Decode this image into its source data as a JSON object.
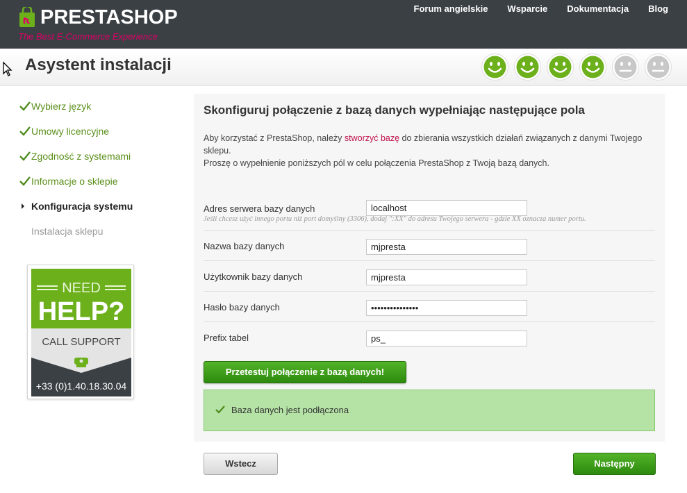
{
  "header": {
    "logo_name": "PRESTASHOP",
    "logo_tagline": "The Best E-Commerce Experience",
    "nav": [
      "Forum angielskie",
      "Wsparcie",
      "Dokumentacja",
      "Blog"
    ]
  },
  "title": "Asystent instalacji",
  "progress": {
    "completed_steps": 4,
    "total_steps": 6
  },
  "sidebar": {
    "steps": [
      {
        "label": "Wybierz język",
        "state": "done"
      },
      {
        "label": "Umowy licencyjne",
        "state": "done"
      },
      {
        "label": "Zgodność z systemami",
        "state": "done"
      },
      {
        "label": "Informacje o sklepie",
        "state": "done"
      },
      {
        "label": "Konfiguracja systemu",
        "state": "current"
      },
      {
        "label": "Instalacja sklepu",
        "state": "pending"
      }
    ]
  },
  "help": {
    "need": "NEED",
    "help": "HELP?",
    "call": "CALL SUPPORT",
    "phone": "+33 (0)1.40.18.30.04"
  },
  "main": {
    "heading": "Skonfiguruj połączenie z bazą danych wypełniając następujące pola",
    "intro_before": "Aby korzystać z PrestaShop, należy ",
    "intro_link": "stworzyć bazę",
    "intro_after": " do zbierania wszystkich działań związanych z danymi Twojego sklepu.",
    "intro_line2": "Proszę o wypełnienie poniższych pól w celu połączenia PrestaShop z Twoją bazą danych.",
    "fields": {
      "server": {
        "label": "Adres serwera bazy danych",
        "value": "localhost",
        "hint": "Jeśli chcesz użyć innego portu niż port domyślny (3306), dodaj \":XX\" do adresu Twojego serwera - gdzie XX oznacza numer portu."
      },
      "dbname": {
        "label": "Nazwa bazy danych",
        "value": "mjpresta"
      },
      "user": {
        "label": "Użytkownik bazy danych",
        "value": "mjpresta"
      },
      "password": {
        "label": "Hasło bazy danych",
        "value": "•••••••••••••••"
      },
      "prefix": {
        "label": "Prefix tabel",
        "value": "ps_"
      }
    },
    "test_button": "Przetestuj połączenie z bazą danych!",
    "status_message": "Baza danych jest podłączona"
  },
  "footer": {
    "back": "Wstecz",
    "next": "Następny"
  },
  "colors": {
    "header_bg": "#3b4045",
    "accent_green": "#2d8a0e",
    "smiley_active": "#6cb01c",
    "smiley_inactive": "#c8c8c8",
    "brand_pink": "#df0067"
  }
}
